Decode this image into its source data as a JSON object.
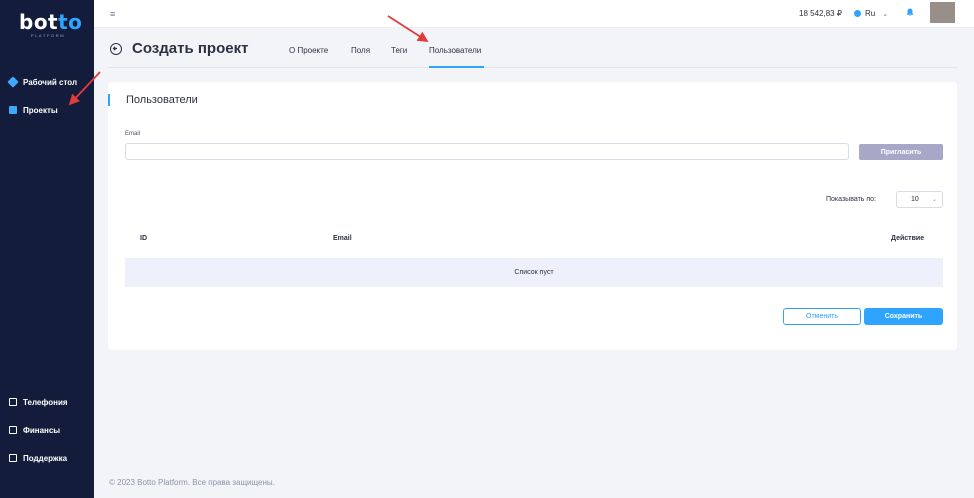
{
  "brand": {
    "logo_main_a": "bot",
    "logo_main_b": "to",
    "logo_sub": "PLATFORM"
  },
  "sidebar": {
    "items": [
      {
        "label": "Рабочий стол",
        "icon": "layers-icon"
      },
      {
        "label": "Проекты",
        "icon": "book-icon"
      },
      {
        "label": "Телефония",
        "icon": "phone-icon"
      },
      {
        "label": "Финансы",
        "icon": "wallet-icon"
      },
      {
        "label": "Поддержка",
        "icon": "support-icon"
      }
    ]
  },
  "topbar": {
    "menu_icon": "≡",
    "balance": "18 542,83 ₽",
    "language": "Ru",
    "bell_icon": "🔔"
  },
  "header": {
    "title": "Создать проект",
    "tabs": [
      {
        "label": "О Проекте"
      },
      {
        "label": "Поля"
      },
      {
        "label": "Теги"
      },
      {
        "label": "Пользователи",
        "active": true
      }
    ]
  },
  "card": {
    "title": "Пользователи",
    "email_label": "Email",
    "email_value": "",
    "invite_button": "Пригласить",
    "show_label": "Показывать по:",
    "per_page": "10",
    "columns": [
      "ID",
      "Email",
      "Действие"
    ],
    "empty_text": "Список пуст",
    "cancel_button": "Отменить",
    "save_button": "Сохранить"
  },
  "footer": {
    "text": "© 2023 Botto Platform. Все права защищены."
  },
  "colors": {
    "sidebar_bg": "#131c3a",
    "accent": "#2fa4ff",
    "invite_disabled": "#a7a7c7",
    "annotation_arrow": "#e03c3c"
  }
}
